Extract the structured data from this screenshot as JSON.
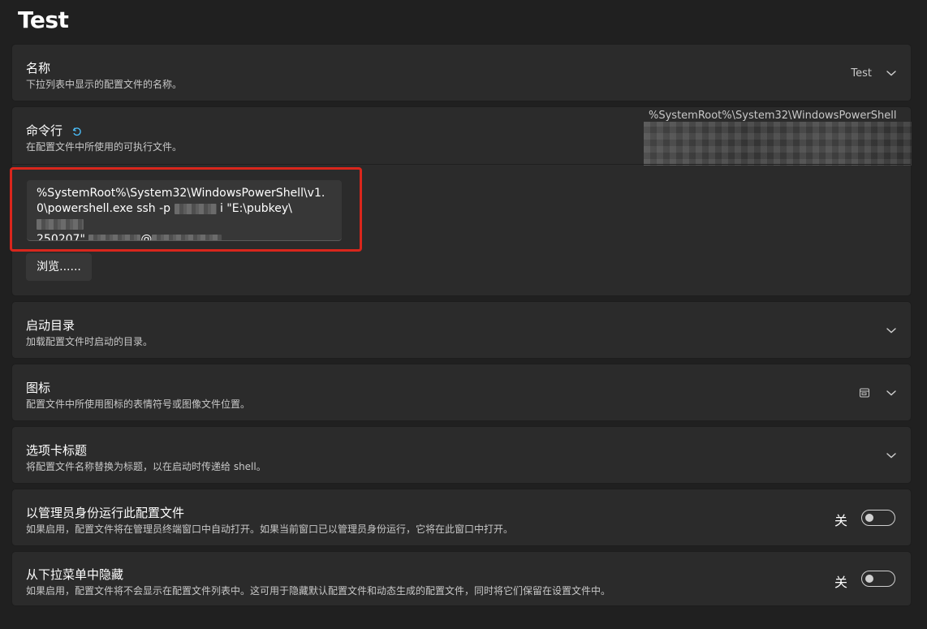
{
  "page": {
    "title": "Test"
  },
  "name_section": {
    "title": "名称",
    "description": "下拉列表中显示的配置文件的名称。",
    "value": "Test"
  },
  "commandline_section": {
    "title": "命令行",
    "description": "在配置文件中所使用的可执行文件。",
    "preview_value": "%SystemRoot%\\System32\\WindowsPowerShell",
    "input_segments": {
      "part1": "%SystemRoot%\\System32\\WindowsPowerShell\\v1.0\\powershell.exe ssh -p ",
      "part2": " i \"E:\\pubkey\\",
      "part3": "250207\" ",
      "part4": "@"
    },
    "browse_label": "浏览......"
  },
  "startdir_section": {
    "title": "启动目录",
    "description": "加载配置文件时启动的目录。"
  },
  "icon_section": {
    "title": "图标",
    "description": "配置文件中所使用图标的表情符号或图像文件位置。"
  },
  "tabtitle_section": {
    "title": "选项卡标题",
    "description": "将配置文件名称替换为标题，以在启动时传递给 shell。"
  },
  "admin_section": {
    "title": "以管理员身份运行此配置文件",
    "description": "如果启用，配置文件将在管理员终端窗口中自动打开。如果当前窗口已以管理员身份运行，它将在此窗口中打开。",
    "toggle_label": "关",
    "toggle_on": false
  },
  "hidden_section": {
    "title": "从下拉菜单中隐藏",
    "description": "如果启用，配置文件将不会显示在配置文件列表中。这可用于隐藏默认配置文件和动态生成的配置文件，同时将它们保留在设置文件中。",
    "toggle_label": "关",
    "toggle_on": false
  },
  "icons": {
    "chevron": "chevron-down-icon",
    "chevron_up": "chevron-up-icon",
    "reset": "reset-icon",
    "image": "image-icon"
  },
  "colors": {
    "background": "#202020",
    "card": "#2b2b2b",
    "accent": "#4cc2ff",
    "highlight_box": "#d9261c"
  }
}
